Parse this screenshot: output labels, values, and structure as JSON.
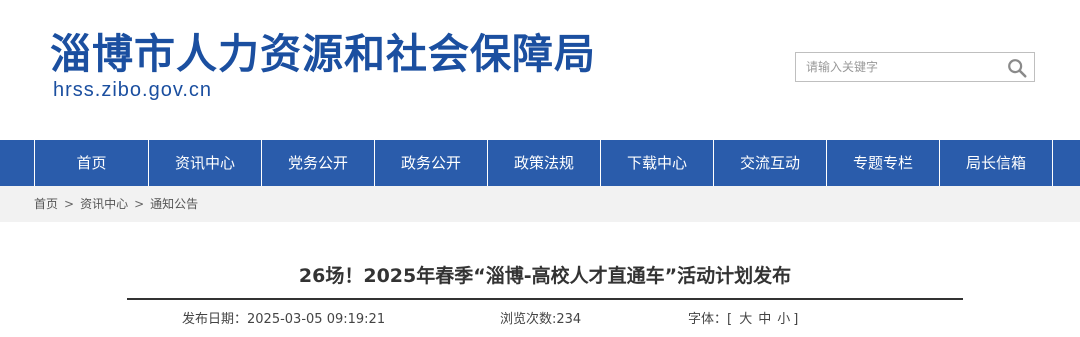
{
  "header": {
    "site_name": "淄博市人力资源和社会保障局",
    "site_domain": "hrss.zibo.gov.cn",
    "brand_color": "#1b4fa0"
  },
  "search": {
    "placeholder": "请输入关键字",
    "icon": "search-icon"
  },
  "nav": {
    "bar_color": "#2a5cab",
    "items": [
      {
        "label": "首页"
      },
      {
        "label": "资讯中心"
      },
      {
        "label": "党务公开"
      },
      {
        "label": "政务公开"
      },
      {
        "label": "政策法规"
      },
      {
        "label": "下载中心"
      },
      {
        "label": "交流互动"
      },
      {
        "label": "专题专栏"
      },
      {
        "label": "局长信箱"
      }
    ]
  },
  "breadcrumb": {
    "items": [
      "首页",
      "资讯中心",
      "通知公告"
    ],
    "separator": ">"
  },
  "article": {
    "title": "26场！2025年春季“淄博-高校人才直通车”活动计划发布",
    "date_label": "发布日期：",
    "date": "2025-03-05 09:19:21",
    "views_label": "浏览次数:",
    "views": "234",
    "font_label": "字体：",
    "font_open": "[",
    "font_large": "大",
    "font_medium": "中",
    "font_small": "小",
    "font_close": "]"
  }
}
